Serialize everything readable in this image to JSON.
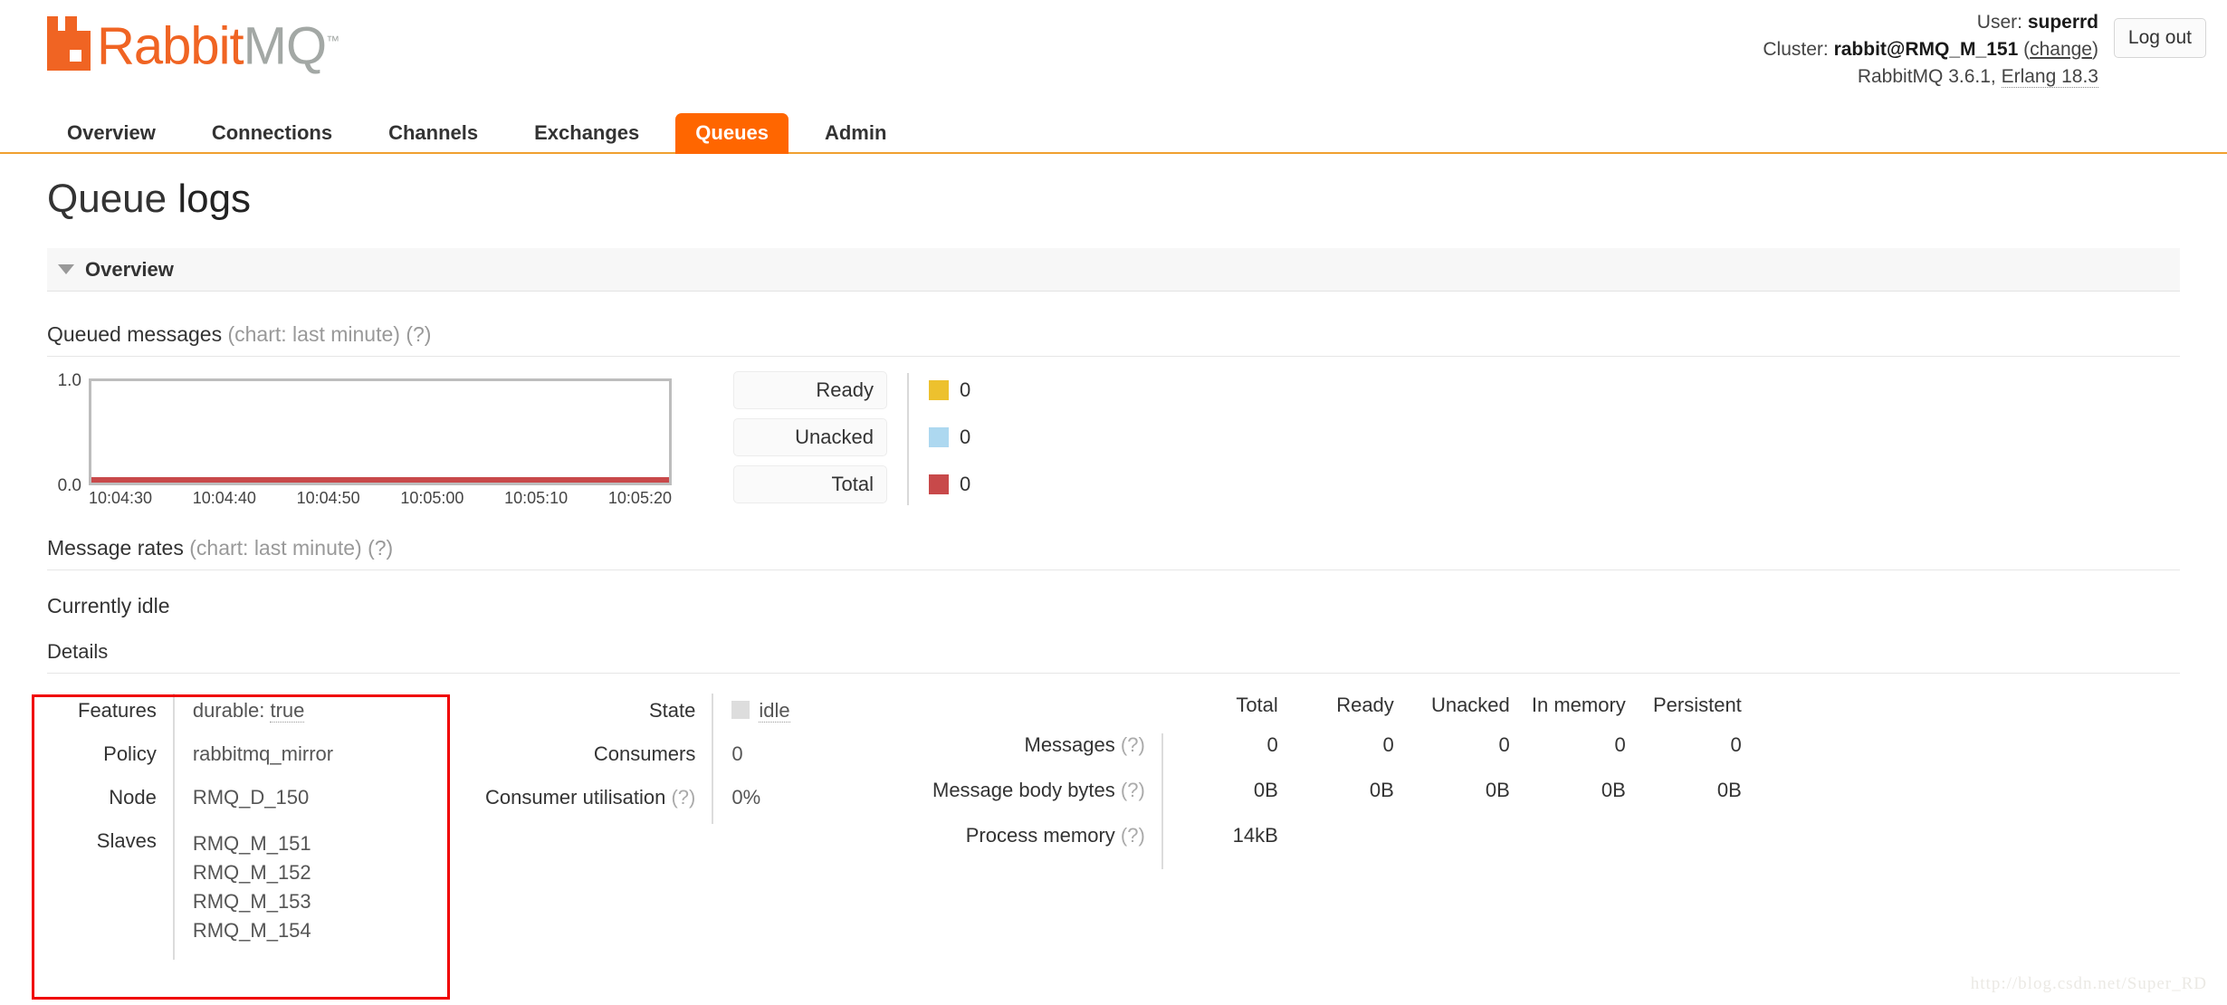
{
  "header": {
    "logo": {
      "rabbit": "Rabbit",
      "mq": "MQ",
      "tm": "™"
    },
    "user_label": "User:",
    "user_name": "superrd",
    "cluster_label": "Cluster:",
    "cluster_name": "rabbit@RMQ_M_151",
    "cluster_change": "change",
    "version": "RabbitMQ 3.6.1,",
    "erlang": "Erlang 18.3",
    "logout_label": "Log out"
  },
  "nav": {
    "items": [
      {
        "label": "Overview",
        "active": false
      },
      {
        "label": "Connections",
        "active": false
      },
      {
        "label": "Channels",
        "active": false
      },
      {
        "label": "Exchanges",
        "active": false
      },
      {
        "label": "Queues",
        "active": true
      },
      {
        "label": "Admin",
        "active": false
      }
    ],
    "active_color": "#FF6600",
    "underline_color": "#F0A030"
  },
  "page": {
    "title_prefix": "Queue",
    "title_name": "logs"
  },
  "overview_section": {
    "label": "Overview",
    "collapse_icon": "triangle-down-icon"
  },
  "queued_messages": {
    "title": "Queued messages",
    "subtitle": "(chart: last minute)",
    "help": "(?)"
  },
  "message_rates": {
    "title": "Message rates",
    "subtitle": "(chart: last minute)",
    "help": "(?)",
    "status": "Currently idle"
  },
  "chart_data": {
    "type": "line",
    "title": "Queued messages (chart: last minute)",
    "xlabel": "",
    "ylabel": "",
    "ylim": [
      0.0,
      1.0
    ],
    "y_ticks": [
      "0.0",
      "1.0"
    ],
    "x_ticks": [
      "10:04:30",
      "10:04:40",
      "10:04:50",
      "10:05:00",
      "10:05:10",
      "10:05:20"
    ],
    "grid": false,
    "legend_position": "right",
    "series": [
      {
        "name": "Ready",
        "color": "#EDC12E",
        "value": "0",
        "values": [
          0,
          0,
          0,
          0,
          0,
          0
        ]
      },
      {
        "name": "Unacked",
        "color": "#ADD8F0",
        "value": "0",
        "values": [
          0,
          0,
          0,
          0,
          0,
          0
        ]
      },
      {
        "name": "Total",
        "color": "#C8494A",
        "value": "0",
        "values": [
          0,
          0,
          0,
          0,
          0,
          0
        ]
      }
    ]
  },
  "details": {
    "heading": "Details",
    "left": {
      "rows": [
        {
          "key": "Features",
          "value_prefix": "durable: ",
          "value_link": "true"
        },
        {
          "key": "Policy",
          "value": "rabbitmq_mirror"
        },
        {
          "key": "Node",
          "value": "RMQ_D_150"
        }
      ],
      "slaves_key": "Slaves",
      "slaves": [
        "RMQ_M_151",
        "RMQ_M_152",
        "RMQ_M_153",
        "RMQ_M_154"
      ]
    },
    "mid": {
      "state_key": "State",
      "state_value": "idle",
      "consumers_key": "Consumers",
      "consumers_value": "0",
      "utilisation_key": "Consumer utilisation",
      "utilisation_help": "(?)",
      "utilisation_value": "0%"
    },
    "stats": {
      "columns": [
        "Total",
        "Ready",
        "Unacked",
        "In memory",
        "Persistent"
      ],
      "rows": [
        {
          "label": "Messages",
          "help": "(?)",
          "values": [
            "0",
            "0",
            "0",
            "0",
            "0"
          ]
        },
        {
          "label": "Message body bytes",
          "help": "(?)",
          "values": [
            "0B",
            "0B",
            "0B",
            "0B",
            "0B"
          ]
        },
        {
          "label": "Process memory",
          "help": "(?)",
          "values": [
            "14kB",
            "",
            "",
            "",
            ""
          ]
        }
      ]
    }
  },
  "annotation": {
    "box_color": "#f00000"
  },
  "watermark": {
    "text": "http://blog.csdn.net/Super_RD"
  }
}
